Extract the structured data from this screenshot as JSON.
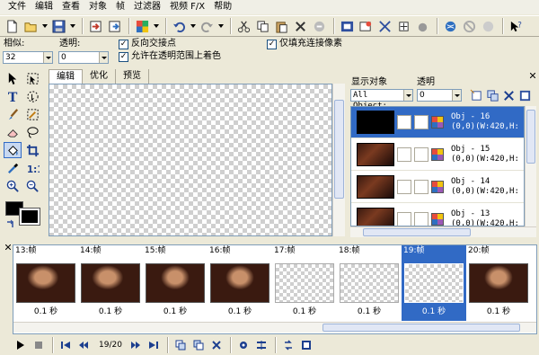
{
  "menu": [
    "文件",
    "编辑",
    "查看",
    "对象",
    "帧",
    "过滤器",
    "视频 F/X",
    "帮助"
  ],
  "toolbar_icons": [
    "new-file-icon",
    "open-folder-icon",
    "save-icon",
    "import-icon",
    "export-icon",
    "palette-icon",
    "undo-icon",
    "redo-icon",
    "cut-icon",
    "copy-icon",
    "paste-icon",
    "delete-icon",
    "crop-icon",
    "film-icon",
    "image-edit-icon",
    "resize-icon",
    "rotate-icon",
    "globe-icon",
    "forbidden-icon",
    "mask-icon",
    "help-pointer-icon"
  ],
  "options": {
    "similarity_label": "相似:",
    "similarity_value": "32",
    "opacity_label": "透明:",
    "opacity_value": "0",
    "invert_label": "反向交接点",
    "allow_label": "允许在透明范围上着色",
    "fill_label": "仅填充连接像素",
    "invert_checked": true,
    "allow_checked": true,
    "fill_checked": true
  },
  "tabs": [
    "编辑",
    "优化",
    "预览"
  ],
  "active_tab": "编辑",
  "right_panel": {
    "display_label": "显示对象",
    "display_value": "All Object:",
    "opacity_label": "透明",
    "opacity_value": "0"
  },
  "objects": [
    {
      "title": "Obj - 16",
      "coords": "(0,0)(W:420,H:",
      "selected": true
    },
    {
      "title": "Obj - 15",
      "coords": "(0,0)(W:420,H:",
      "selected": false
    },
    {
      "title": "Obj - 14",
      "coords": "(0,0)(W:420,H:",
      "selected": false
    },
    {
      "title": "Obj - 13",
      "coords": "(0,0)(W:420,H:",
      "selected": false
    }
  ],
  "frames": [
    {
      "label": "13:帧",
      "delay": "0.1 秒",
      "has_image": true,
      "selected": false
    },
    {
      "label": "14:帧",
      "delay": "0.1 秒",
      "has_image": true,
      "selected": false
    },
    {
      "label": "15:帧",
      "delay": "0.1 秒",
      "has_image": true,
      "selected": false
    },
    {
      "label": "16:帧",
      "delay": "0.1 秒",
      "has_image": true,
      "selected": false
    },
    {
      "label": "17:帧",
      "delay": "0.1 秒",
      "has_image": false,
      "selected": false
    },
    {
      "label": "18:帧",
      "delay": "0.1 秒",
      "has_image": false,
      "selected": false
    },
    {
      "label": "19:帧",
      "delay": "0.1 秒",
      "has_image": false,
      "selected": true
    },
    {
      "label": "20:帧",
      "delay": "0.1 秒",
      "has_image": true,
      "selected": false
    }
  ],
  "frame_counter": "19/20",
  "colors": {
    "selection": "#316ac5",
    "chrome": "#ece9d8",
    "border": "#7f9db9"
  }
}
